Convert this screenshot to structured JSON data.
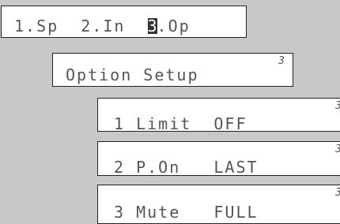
{
  "menu_bar": {
    "item1": "1.Sp",
    "item2": "2.In",
    "cursor_digit": "3",
    "item3_rest": ".Op"
  },
  "option_setup": {
    "title": "Option Setup",
    "index": "3"
  },
  "rows": [
    {
      "label": "1 Limit  OFF",
      "index": "3"
    },
    {
      "label": "2 P.On   LAST",
      "index": "3"
    },
    {
      "label": "3 Mute   FULL",
      "index": "3"
    }
  ]
}
